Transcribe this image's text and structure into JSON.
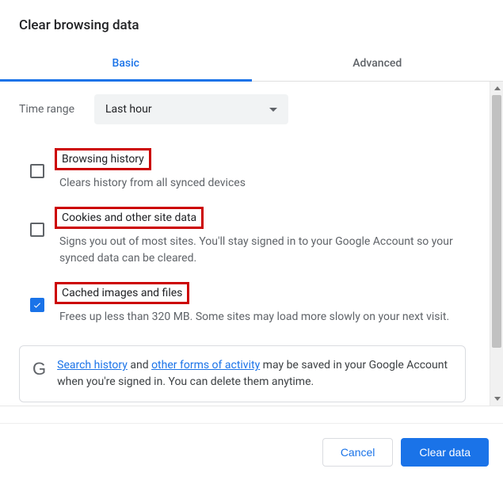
{
  "title": "Clear browsing data",
  "tabs": {
    "basic": "Basic",
    "advanced": "Advanced"
  },
  "time_range": {
    "label": "Time range",
    "selected": "Last hour"
  },
  "options": [
    {
      "title": "Browsing history",
      "desc": "Clears history from all synced devices",
      "checked": false
    },
    {
      "title": "Cookies and other site data",
      "desc": "Signs you out of most sites. You'll stay signed in to your Google Account so your synced data can be cleared.",
      "checked": false
    },
    {
      "title": "Cached images and files",
      "desc": "Frees up less than 320 MB. Some sites may load more slowly on your next visit.",
      "checked": true
    }
  ],
  "info": {
    "icon": "G",
    "link1": "Search history",
    "text1": " and ",
    "link2": "other forms of activity",
    "text2": " may be saved in your Google Account when you're signed in. You can delete them anytime."
  },
  "buttons": {
    "cancel": "Cancel",
    "clear": "Clear data"
  }
}
